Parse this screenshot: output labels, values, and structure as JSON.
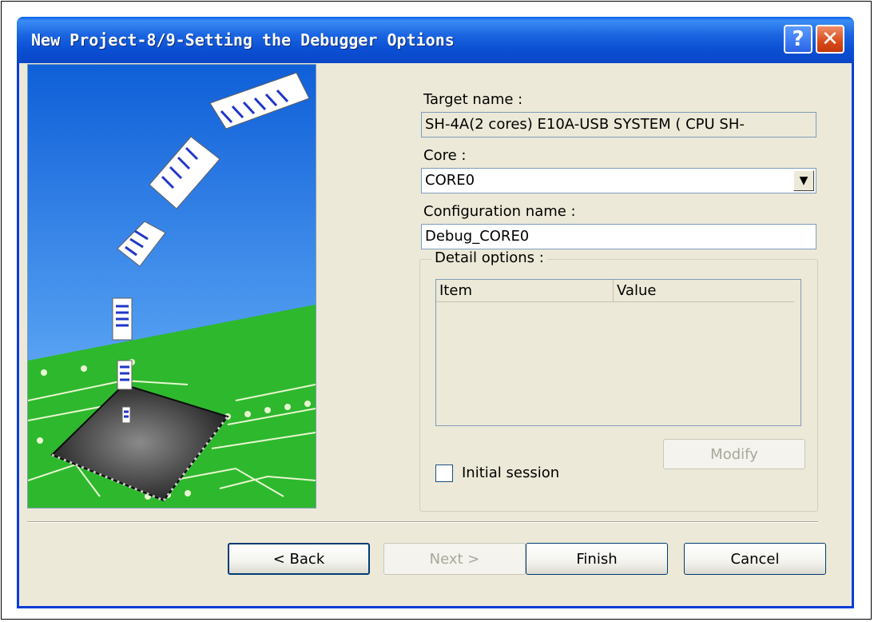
{
  "window": {
    "title": "New Project-8/9-Setting the Debugger Options",
    "help_label": "?",
    "close_label": "✕"
  },
  "form": {
    "target_label": "Target name :",
    "target_value": "SH-4A(2 cores) E10A-USB SYSTEM ( CPU SH-",
    "core_label": "Core :",
    "core_value": "CORE0",
    "config_label": "Configuration name :",
    "config_value": "Debug_CORE0"
  },
  "detail": {
    "legend": "Detail options :",
    "columns": [
      "Item",
      "Value"
    ],
    "modify_label": "Modify",
    "initial_session_label": "Initial session",
    "initial_session_checked": false
  },
  "buttons": {
    "back": "< Back",
    "next": "Next >",
    "finish": "Finish",
    "cancel": "Cancel"
  },
  "colors": {
    "titlebar": "#0a4fd3",
    "dialog_bg": "#ece9d8",
    "art_sky": "#1e6fe0",
    "art_board": "#2eb82e"
  }
}
